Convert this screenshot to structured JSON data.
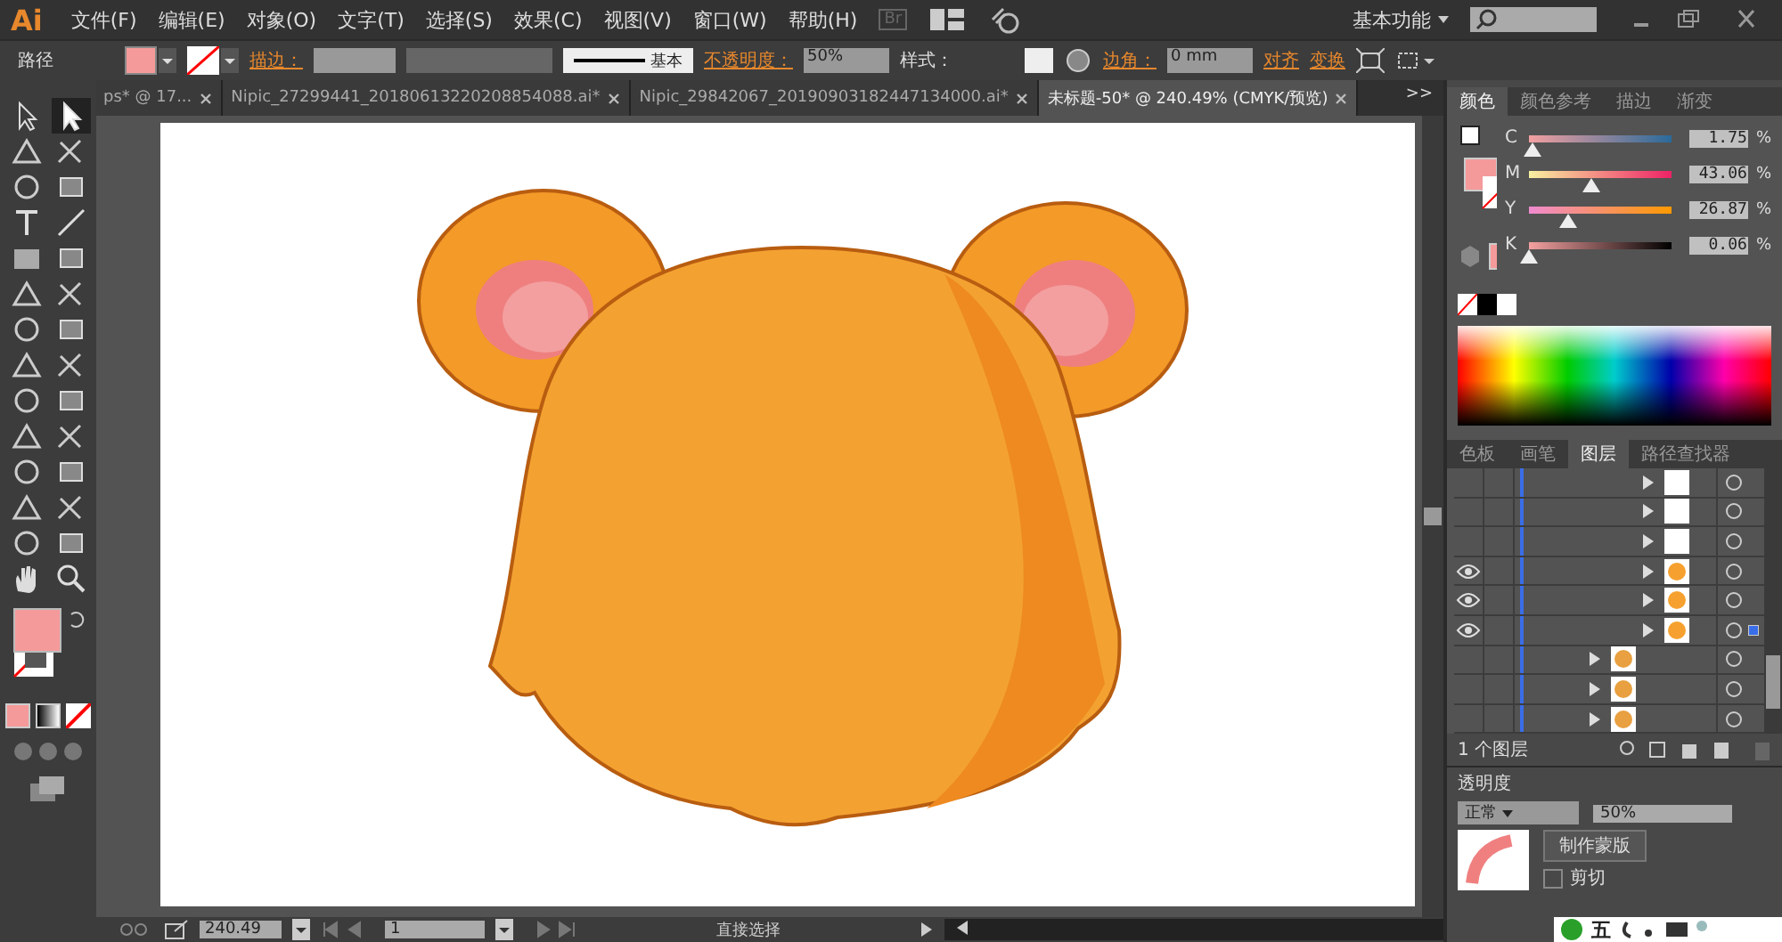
{
  "menu_bar": {
    "logo": "Ai",
    "items": [
      "文件(F)",
      "编辑(E)",
      "对象(O)",
      "文字(T)",
      "选择(S)",
      "效果(C)",
      "视图(V)",
      "窗口(W)",
      "帮助(H)"
    ],
    "bridge": "Br",
    "workspace": "基本功能"
  },
  "control_bar": {
    "selection": "路径",
    "stroke_label": "描边：",
    "stroke_profile": "基本",
    "opacity_label": "不透明度：",
    "opacity": "50%",
    "style_label": "样式：",
    "corner_label": "边角：",
    "corner": "0 mm",
    "align": "对齐",
    "transform": "变换"
  },
  "tools": [
    {
      "selected": false
    },
    {
      "selected": true
    },
    {
      "selected": false
    },
    {
      "selected": false
    },
    {
      "selected": false
    },
    {
      "selected": false
    },
    {
      "selected": false
    },
    {
      "selected": false
    },
    {
      "selected": false
    },
    {
      "selected": false
    },
    {
      "selected": false
    },
    {
      "selected": false
    },
    {
      "selected": false
    },
    {
      "selected": false
    },
    {
      "selected": false
    },
    {
      "selected": false
    },
    {
      "selected": false
    },
    {
      "selected": false
    },
    {
      "selected": false
    },
    {
      "selected": false
    },
    {
      "selected": false
    },
    {
      "selected": false
    },
    {
      "selected": false
    },
    {
      "selected": false
    },
    {
      "selected": false
    },
    {
      "selected": false
    },
    {
      "selected": false
    },
    {
      "selected": false
    }
  ],
  "document_tabs": [
    {
      "label": "ps* @ 17...",
      "selected": false
    },
    {
      "label": "Nipic_27299441_20180613220208854088.ai*",
      "selected": false
    },
    {
      "label": "Nipic_29842067_20190903182447134000.ai*",
      "selected": false
    },
    {
      "label": "未标题-50* @ 240.49% (CMYK/预览)",
      "selected": true
    }
  ],
  "tabs_overflow": ">>",
  "color_panel": {
    "tabs": [
      {
        "label": "颜色",
        "selected": true
      },
      {
        "label": "颜色参考",
        "selected": false
      },
      {
        "label": "描边",
        "selected": false
      },
      {
        "label": "渐变",
        "selected": false
      }
    ],
    "channels": [
      {
        "name": "C",
        "level": 0.0175,
        "value": "1.75"
      },
      {
        "name": "M",
        "level": 0.4306,
        "value": "43.06"
      },
      {
        "name": "Y",
        "level": 0.2687,
        "value": "26.87"
      },
      {
        "name": "K",
        "level": 0.0006,
        "value": "0.06"
      }
    ],
    "unit": "%"
  },
  "layers_panel": {
    "tabs": [
      {
        "label": "色板",
        "selected": false
      },
      {
        "label": "画笔",
        "selected": false
      },
      {
        "label": "图层",
        "selected": true
      },
      {
        "label": "路径查找器",
        "selected": false
      }
    ],
    "rows": [
      {
        "kind": "item",
        "visible": false,
        "selected": false
      },
      {
        "kind": "item",
        "visible": false,
        "selected": false
      },
      {
        "kind": "item",
        "visible": false,
        "selected": false
      },
      {
        "kind": "item",
        "visible": true,
        "selected": false
      },
      {
        "kind": "item",
        "visible": true,
        "selected": false
      },
      {
        "kind": "item",
        "visible": true,
        "selected": true
      },
      {
        "kind": "group",
        "visible": false,
        "selected": false
      },
      {
        "kind": "group",
        "visible": false,
        "selected": false
      },
      {
        "kind": "group",
        "visible": false,
        "selected": false
      }
    ],
    "footer": "1 个图层"
  },
  "transparency_panel": {
    "title": "透明度",
    "blend": "正常",
    "opacity": "50%",
    "make_mask": "制作蒙版",
    "clip": "剪切",
    "clip_checked": false
  },
  "ime_bar": {
    "mode": "五"
  },
  "status_bar": {
    "zoom": "240.49",
    "artboard": "1",
    "tool": "直接选择"
  }
}
